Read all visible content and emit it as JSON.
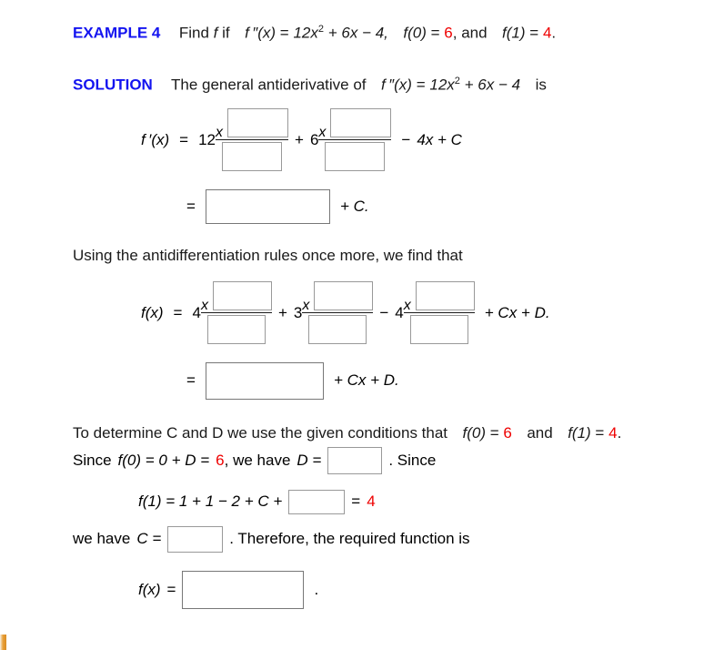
{
  "document": {
    "title_label": "EXAMPLE 4",
    "solution_label": "SOLUTION"
  },
  "problem": {
    "prompt_pre": "Find",
    "f_italic": "f",
    "prompt_if": "if",
    "fpp": "f ″(x)",
    "eq": "=",
    "expr_lead": "12x",
    "expr_exp": "2",
    "expr_rest": "+ 6x − 4,",
    "cond1_fn": "f(0)",
    "cond1_eq": "=",
    "cond1_val": "6",
    "conj": ", and",
    "cond2_fn": "f(1)",
    "cond2_eq": "=",
    "cond2_val": "4",
    "period": "."
  },
  "solution_intro": {
    "text_before": "The general antiderivative of",
    "fpp": "f ″(x)",
    "eq": "=",
    "expr_lead": "12x",
    "expr_exp": "2",
    "expr_rest": "+ 6x − 4",
    "text_after": "is"
  },
  "equation1": {
    "lhs": "f ′(x)",
    "eq": "=",
    "term1_coef": "12",
    "term1_base": "x",
    "term1_exp_box": "",
    "term1_den_box": "",
    "op1": "+",
    "term2_coef": "6",
    "term2_base": "x",
    "term2_exp_box": "",
    "term2_den_box": "",
    "op2": "−",
    "tail": "4x + C"
  },
  "equation2": {
    "eq": "=",
    "answer_box": "",
    "tail": "+ C."
  },
  "midtext": "Using the antidifferentiation rules once more, we find that",
  "equation3": {
    "lhs": "f(x)",
    "eq": "=",
    "term1_coef": "4",
    "term1_base": "x",
    "term1_exp_box": "",
    "term1_den_box": "",
    "op1": "+",
    "term2_coef": "3",
    "term2_base": "x",
    "term2_exp_box": "",
    "term2_den_box": "",
    "op2": "−",
    "term3_coef": "4",
    "term3_base": "x",
    "term3_exp_box": "",
    "term3_den_box": "",
    "tail": "+ Cx + D."
  },
  "equation4": {
    "eq": "=",
    "answer_box": "",
    "tail": "+ Cx + D."
  },
  "determine": {
    "line1_a": "To determine C and D we use the given conditions that",
    "line1_fn1": "f(0)",
    "line1_eq1": "=",
    "line1_val1": "6",
    "line1_and": "and",
    "line1_fn2": "f(1)",
    "line1_eq2": "=",
    "line1_val2": "4",
    "line1_period": ".",
    "line2_a": "Since",
    "line2_expr": "f(0) = 0 + D =",
    "line2_val": "6",
    "line2_b": ",  we have",
    "line2_D": "D =",
    "line2_box": "",
    "line2_c": ".  Since"
  },
  "equation5": {
    "lhs": "f(1) = 1 + 1 − 2 + C +",
    "box": "",
    "eq": "=",
    "val": "4"
  },
  "have_c": {
    "pre": "we have",
    "c_label": "C =",
    "box": "",
    "post": ".  Therefore, the required function is"
  },
  "equation6": {
    "lhs": "f(x)",
    "eq": "=",
    "box": "",
    "period": "."
  },
  "colors": {
    "heading_blue": "#1414f0",
    "value_red": "#ee0000",
    "box_border": "#999999",
    "box_border_dark": "#777777",
    "marker_orange": "#e9a13b",
    "text": "#1a1a1a",
    "background": "#ffffff"
  }
}
